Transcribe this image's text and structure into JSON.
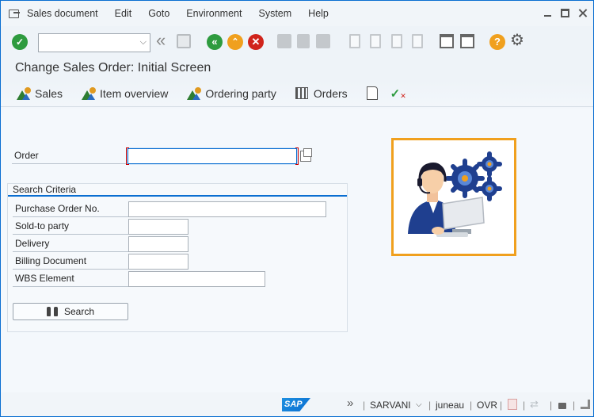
{
  "menu": {
    "items": [
      "Sales document",
      "Edit",
      "Goto",
      "Environment",
      "System",
      "Help"
    ]
  },
  "toolbar": {
    "command_field_value": "",
    "icons": [
      "enter-icon",
      "back-double-icon",
      "save-icon",
      "back-icon",
      "exit-icon",
      "cancel-icon",
      "print-icon",
      "find-icon",
      "find-next-icon",
      "first-page-icon",
      "prev-page-icon",
      "next-page-icon",
      "last-page-icon",
      "new-session-icon",
      "shortcut-icon",
      "help-icon",
      "settings-icon"
    ]
  },
  "title": "Change Sales Order: Initial Screen",
  "app_toolbar": {
    "sales": "Sales",
    "item_overview": "Item overview",
    "ordering_party": "Ordering party",
    "orders": "Orders"
  },
  "form": {
    "order_label": "Order",
    "order_value": "",
    "group_title": "Search Criteria",
    "fields": [
      {
        "label": "Purchase Order No.",
        "value": ""
      },
      {
        "label": "Sold-to party",
        "value": ""
      },
      {
        "label": "Delivery",
        "value": ""
      },
      {
        "label": "Billing Document",
        "value": ""
      },
      {
        "label": "WBS Element",
        "value": ""
      }
    ],
    "search_button": "Search"
  },
  "status": {
    "logo": "SAP",
    "user": "SARVANI",
    "server": "juneau",
    "mode": "OVR"
  },
  "colors": {
    "accent": "#0a6ed1",
    "illustration_border": "#f0a01e",
    "enter_green": "#2e9b3f",
    "exit_orange": "#f0a01e",
    "cancel_red": "#d0231b"
  }
}
